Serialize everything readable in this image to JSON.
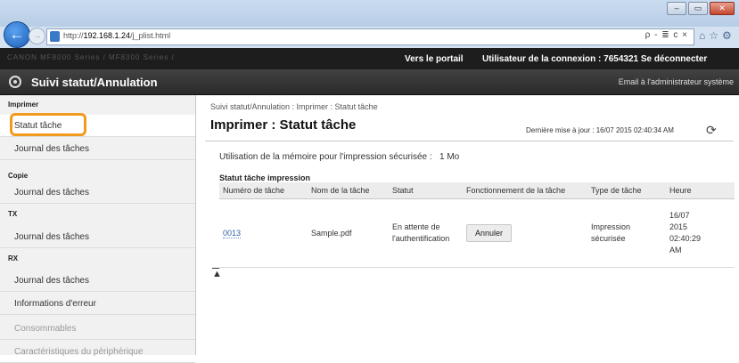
{
  "browser": {
    "url_prefix": "http://",
    "url_host": "192.168.1.24",
    "url_path": "/j_plist.html",
    "address_controls": "ρ - ≣ c ×",
    "window_buttons": {
      "minimize": "–",
      "maximize": "▭",
      "close": "✕"
    },
    "back_glyph": "←",
    "forward_glyph": "→"
  },
  "header": {
    "brand": "CANON   MF8000 Series / MF8300 Series /",
    "portal_link": "Vers le portail",
    "user_info": "Utilisateur de la connexion :  7654321   Se déconnecter",
    "app_title": "Suivi statut/Annulation",
    "email_admin": "Email à l'administrateur système"
  },
  "sidebar": {
    "sections": [
      {
        "title": "Imprimer",
        "items": [
          "Statut tâche",
          "Journal des tâches"
        ]
      },
      {
        "title": "Copie",
        "items": [
          "Journal des tâches"
        ]
      },
      {
        "title": "TX",
        "items": [
          "Journal des tâches"
        ]
      },
      {
        "title": "RX",
        "items": [
          "Journal des tâches"
        ]
      }
    ],
    "extra_items": [
      "Informations d'erreur",
      "Consommables",
      "Caractéristiques du périphérique"
    ]
  },
  "main": {
    "breadcrumb": "Suivi statut/Annulation : Imprimer : Statut tâche",
    "title": "Imprimer : Statut tâche",
    "last_update": "Dernière mise à jour : 16/07 2015 02:40:34 AM",
    "memory_label": "Utilisation de la mémoire pour l'impression sécurisée :",
    "memory_value": "1 Mo",
    "table_caption": "Statut tâche impression",
    "columns": [
      "Numéro de tâche",
      "Nom de la tâche",
      "Statut",
      "Fonctionnement de la tâche",
      "Type de tâche",
      "Heure"
    ],
    "rows": [
      {
        "job_number": "0013",
        "job_name": "Sample.pdf",
        "status_line1": "En attente de",
        "status_line2": "l'authentification",
        "action": "Annuler",
        "type_line1": "Impression",
        "type_line2": "sécurisée",
        "time_line1": "16/07",
        "time_line2": "2015",
        "time_line3": "02:40:29",
        "time_line4": "AM"
      }
    ]
  },
  "colors": {
    "highlight": "#f39a1e",
    "link": "#2e5fa8",
    "header_bg": "#1d1d1d"
  }
}
